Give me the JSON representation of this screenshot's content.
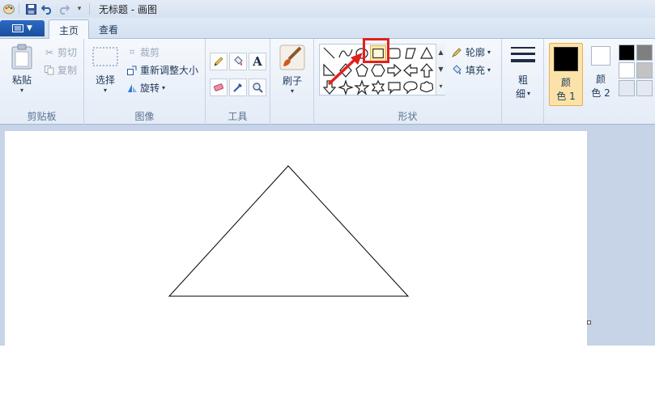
{
  "titlebar": {
    "title": "无标题 - 画图",
    "quick_access": [
      "paint-app-icon",
      "save-icon",
      "undo-icon",
      "redo-icon",
      "customize-dropdown-icon"
    ]
  },
  "tabs": {
    "file_label": "",
    "home_label": "主页",
    "view_label": "查看"
  },
  "clipboard": {
    "group_label": "剪贴板",
    "paste_label": "粘贴",
    "cut_label": "剪切",
    "copy_label": "复制"
  },
  "image": {
    "group_label": "图像",
    "select_label": "选择",
    "crop_label": "裁剪",
    "resize_label": "重新调整大小",
    "rotate_label": "旋转"
  },
  "tools": {
    "group_label": "工具",
    "items": [
      "pencil-icon",
      "fill-icon",
      "text-icon",
      "eraser-icon",
      "color-picker-icon",
      "magnifier-icon"
    ]
  },
  "brushes": {
    "label": "刷子"
  },
  "shapes": {
    "group_label": "形状",
    "outline_label": "轮廓",
    "fill_label": "填充",
    "items": [
      "line-shape",
      "curve-shape",
      "oval-shape",
      "rectangle-shape",
      "rounded-rectangle-shape",
      "polygon-shape",
      "triangle-shape",
      "right-triangle-shape",
      "diamond-shape",
      "pentagon-shape",
      "hexagon-shape",
      "right-arrow-shape",
      "left-arrow-shape",
      "up-arrow-shape",
      "down-arrow-shape",
      "four-point-star-shape",
      "five-point-star-shape",
      "six-point-star-shape",
      "rect-callout-shape",
      "oval-callout-shape",
      "cloud-callout-shape"
    ],
    "highlighted": "rectangle-shape"
  },
  "size": {
    "label_line1": "粗",
    "label_line2": "细"
  },
  "colors": {
    "color1_line1": "颜",
    "color1_line2": "色 1",
    "color2_line1": "颜",
    "color2_line2": "色 2",
    "color1_value": "#000000",
    "color2_value": "#ffffff",
    "palette": [
      "#000000",
      "#7f7f7f",
      "#ffffff",
      "#c3c3c3",
      "#ffffff",
      "#ffffff"
    ],
    "accent": "#e1201e"
  }
}
